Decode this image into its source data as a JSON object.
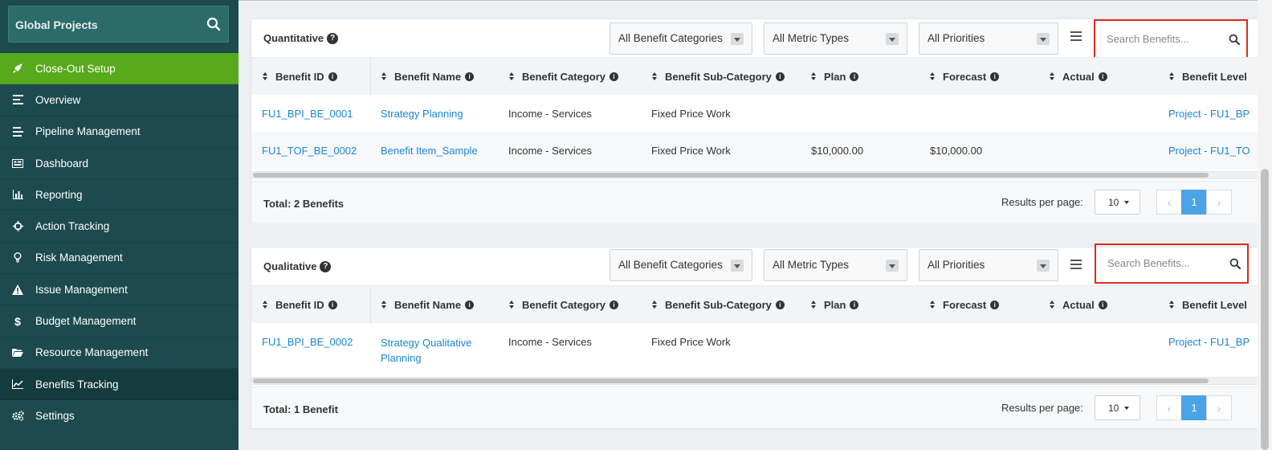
{
  "sidebar": {
    "search_label": "Global Projects",
    "items": [
      {
        "label": "Close-Out Setup",
        "icon": "rocket-icon"
      },
      {
        "label": "Overview",
        "icon": "list-icon"
      },
      {
        "label": "Pipeline Management",
        "icon": "pipeline-icon"
      },
      {
        "label": "Dashboard",
        "icon": "dashboard-icon"
      },
      {
        "label": "Reporting",
        "icon": "bar-chart-icon"
      },
      {
        "label": "Action Tracking",
        "icon": "crosshair-icon"
      },
      {
        "label": "Risk Management",
        "icon": "lightbulb-icon"
      },
      {
        "label": "Issue Management",
        "icon": "warning-icon"
      },
      {
        "label": "Budget Management",
        "icon": "dollar-icon"
      },
      {
        "label": "Resource Management",
        "icon": "folder-icon"
      },
      {
        "label": "Benefits Tracking",
        "icon": "line-chart-icon"
      },
      {
        "label": "Settings",
        "icon": "gears-icon"
      }
    ]
  },
  "columns": [
    "Benefit ID",
    "Benefit Name",
    "Benefit Category",
    "Benefit Sub-Category",
    "Plan",
    "Forecast",
    "Actual",
    "Benefit Level"
  ],
  "filters": {
    "categories": "All Benefit Categories",
    "metrics": "All Metric Types",
    "priorities": "All Priorities",
    "search_placeholder": "Search Benefits..."
  },
  "quantitative": {
    "title": "Quantitative",
    "rows": [
      {
        "id": "FU1_BPI_BE_0001",
        "name": "Strategy Planning",
        "category": "Income - Services",
        "subcategory": "Fixed Price Work",
        "plan": "",
        "forecast": "",
        "actual": "",
        "level": "Project - FU1_BP"
      },
      {
        "id": "FU1_TOF_BE_0002",
        "name": "Benefit Item_Sample",
        "category": "Income - Services",
        "subcategory": "Fixed Price Work",
        "plan": "$10,000.00",
        "forecast": "$10,000.00",
        "actual": "",
        "level": "Project - FU1_TO"
      }
    ],
    "total": "Total: 2 Benefits",
    "results_label": "Results per page:",
    "per_page": "10",
    "page": "1"
  },
  "qualitative": {
    "title": "Qualitative",
    "rows": [
      {
        "id": "FU1_BPI_BE_0002",
        "name": "Strategy Qualitative Planning",
        "category": "Income - Services",
        "subcategory": "Fixed Price Work",
        "plan": "",
        "forecast": "",
        "actual": "",
        "level": "Project - FU1_BP"
      }
    ],
    "total": "Total: 1 Benefit",
    "results_label": "Results per page:",
    "per_page": "10",
    "page": "1"
  },
  "colors": {
    "sidebar_bg": "#1d4a4e",
    "active_item": "#57aa19",
    "link": "#1a85d6",
    "highlight_box": "#e02a20",
    "page_active": "#4aa3e4"
  }
}
